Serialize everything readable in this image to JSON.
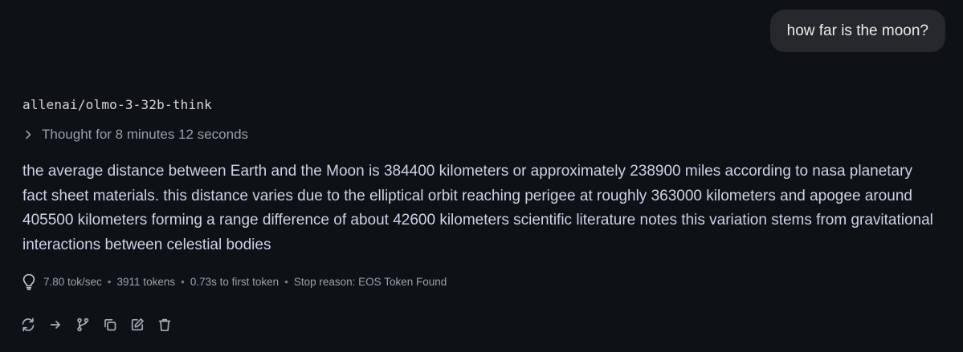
{
  "user_message": {
    "text": "how far is the moon?"
  },
  "assistant": {
    "model_name": "allenai/olmo-3-32b-think",
    "thought_label": "Thought for 8 minutes 12 seconds",
    "response_text": "the average distance between Earth and the Moon is 384400 kilometers or approximately 238900 miles according to nasa planetary fact sheet materials. this distance varies due to the elliptical orbit reaching perigee at roughly 363000 kilometers and apogee around 405500 kilometers forming a range difference of about 42600 kilometers scientific literature notes this variation stems from gravitational interactions between celestial bodies",
    "stats": {
      "tok_per_sec": "7.80 tok/sec",
      "tokens": "3911 tokens",
      "first_token": "0.73s to first token",
      "stop_reason": "Stop reason: EOS Token Found",
      "separator": "•"
    },
    "icons": {
      "stats": "lightbulb-icon",
      "thought": "chevron-right-icon",
      "actions": [
        "regenerate-icon",
        "continue-arrow-icon",
        "branch-icon",
        "copy-icon",
        "edit-icon",
        "delete-icon"
      ]
    }
  },
  "colors": {
    "background": "#0e1116",
    "user_bubble": "#26282c",
    "response_text": "#ced1e6",
    "muted_text": "#9a9ea6"
  }
}
